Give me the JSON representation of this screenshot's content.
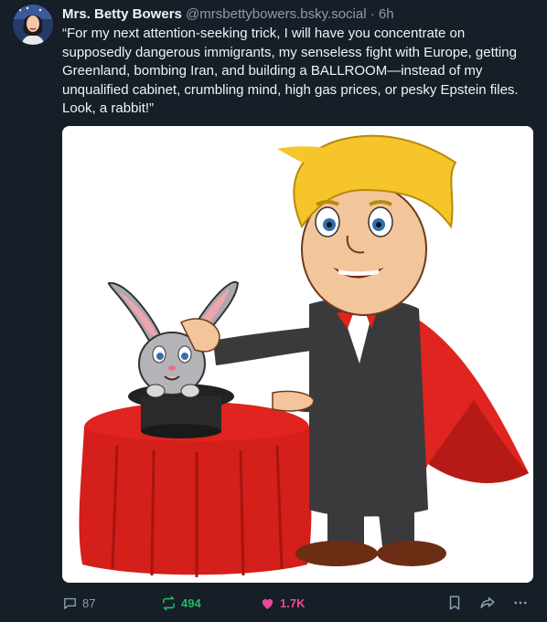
{
  "post": {
    "author_name": "Mrs. Betty Bowers",
    "handle": "@mrsbettybowers.bsky.social",
    "separator": "·",
    "time": "6h",
    "text": "“For my next attention-seeking trick, I will have you concentrate on supposedly dangerous immigrants, my senseless fight with Europe, getting Greenland, bombing Iran, and building a BALLROOM—instead of my unqualified cabinet, crumbling mind, high gas prices, or pesky Epstein files. Look, a rabbit!”"
  },
  "actions": {
    "reply_count": "87",
    "repost_count": "494",
    "like_count": "1.7K"
  },
  "colors": {
    "background": "#161e27",
    "repost": "#20bc61",
    "like": "#ec4899",
    "muted": "#8c9db0"
  },
  "icons": [
    "reply-icon",
    "repost-icon",
    "heart-icon",
    "bookmark-icon",
    "share-icon",
    "more-icon"
  ]
}
